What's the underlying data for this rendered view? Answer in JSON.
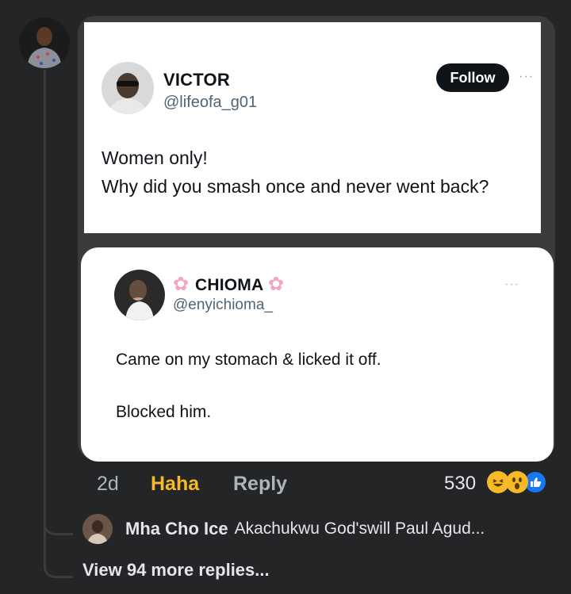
{
  "post": {
    "tweet1": {
      "name": "VICTOR",
      "handle": "@lifeofa_g01",
      "follow_label": "Follow",
      "more": "···",
      "line1": "Women only!",
      "line2": "Why did you smash once and never went back?"
    },
    "tweet2": {
      "name": "CHIOMA",
      "handle": "@enyichioma_",
      "more": "···",
      "line1": "Came on my stomach & licked it off.",
      "line2": "Blocked him."
    }
  },
  "actions": {
    "time": "2d",
    "haha": "Haha",
    "reply": "Reply",
    "reaction_count": "530"
  },
  "reply_preview": {
    "name": "Mha Cho Ice",
    "text": "Akachukwu God'swill Paul Agud..."
  },
  "view_more": "View 94 more replies...",
  "colors": {
    "background": "#242526",
    "haha": "#f7b928",
    "like": "#1877f2"
  }
}
